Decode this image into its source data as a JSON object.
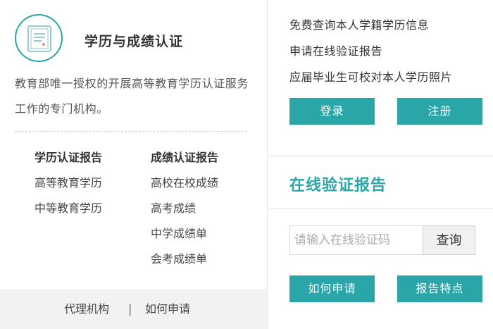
{
  "left": {
    "title": "学历与成绩认证",
    "description": "教育部唯一授权的开展高等教育学历认证服务工作的专门机构。",
    "col1": {
      "heading": "学历认证报告",
      "items": [
        "高等教育学历",
        "中等教育学历"
      ]
    },
    "col2": {
      "heading": "成绩认证报告",
      "items": [
        "高校在校成绩",
        "高考成绩",
        "中学成绩单",
        "会考成绩单"
      ]
    },
    "footer": {
      "link1": "代理机构",
      "separator": "|",
      "link2": "如何申请"
    }
  },
  "right": {
    "links": [
      "免费查询本人学籍学历信息",
      "申请在线验证报告",
      "应届毕业生可校对本人学历照片"
    ],
    "login_label": "登录",
    "register_label": "注册",
    "section_title": "在线验证报告",
    "verify": {
      "placeholder": "请输入在线验证码",
      "query_label": "查询"
    },
    "how_apply_label": "如何申请",
    "features_label": "报告特点"
  },
  "colors": {
    "accent": "#2aa5a8",
    "footer_bg": "#f2f2f2"
  },
  "icons": {
    "logo": "certificate-icon"
  }
}
